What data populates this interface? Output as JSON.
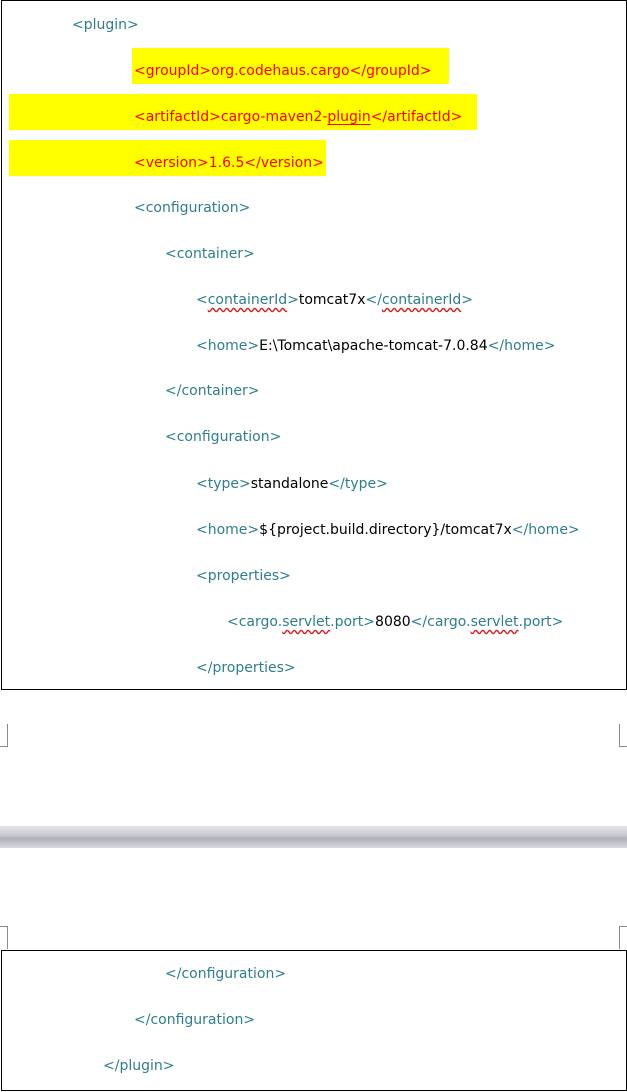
{
  "lines": {
    "plugin_open": "<plugin>",
    "groupId_open": "<groupId>",
    "groupId_val": "org.codehaus.cargo",
    "groupId_close": "</groupId>",
    "artifact_open": "<artifactId>",
    "artifact_val1": "cargo-maven2-",
    "artifact_val2": "plugin",
    "artifact_close": "</artifactId>",
    "version_open": "<version>",
    "version_val": "1.6.5",
    "version_close": "</version>",
    "configuration_open": "<configuration>",
    "container_open": "<container>",
    "containerId_lt": "<",
    "containerId_name": "containerId",
    "containerId_gt": ">",
    "containerId_val": "tomcat7x",
    "containerId_close_lt": "</",
    "containerId_close_name": "containerId",
    "containerId_close_gt": ">",
    "home_open": "<home>",
    "home_val": "E:\\Tomcat\\apache-tomcat-7.0.84",
    "home_close": "</home>",
    "container_close": "</container>",
    "config2_open": "<configuration>",
    "type_open": "<type>",
    "type_val": "standalone",
    "type_close": "</type>",
    "home2_open": "<home>",
    "home2_val": "${project.build.directory}/tomcat7x",
    "home2_close": "</home>",
    "properties_open": "<properties>",
    "port_open1": "<cargo.",
    "port_open2": "servlet",
    "port_open3": ".port>",
    "port_val": "8080",
    "port_close1": "</cargo.",
    "port_close2": "servlet",
    "port_close3": ".port>",
    "properties_close": "</properties>",
    "config2_close": "</configuration>",
    "configuration_close": "</configuration>",
    "plugin_close": "</plugin>"
  },
  "colors": {
    "tag": "#2f7e8c",
    "highlighted_text": "#ff0000",
    "highlight": "#ffff00",
    "value": "#000000"
  }
}
